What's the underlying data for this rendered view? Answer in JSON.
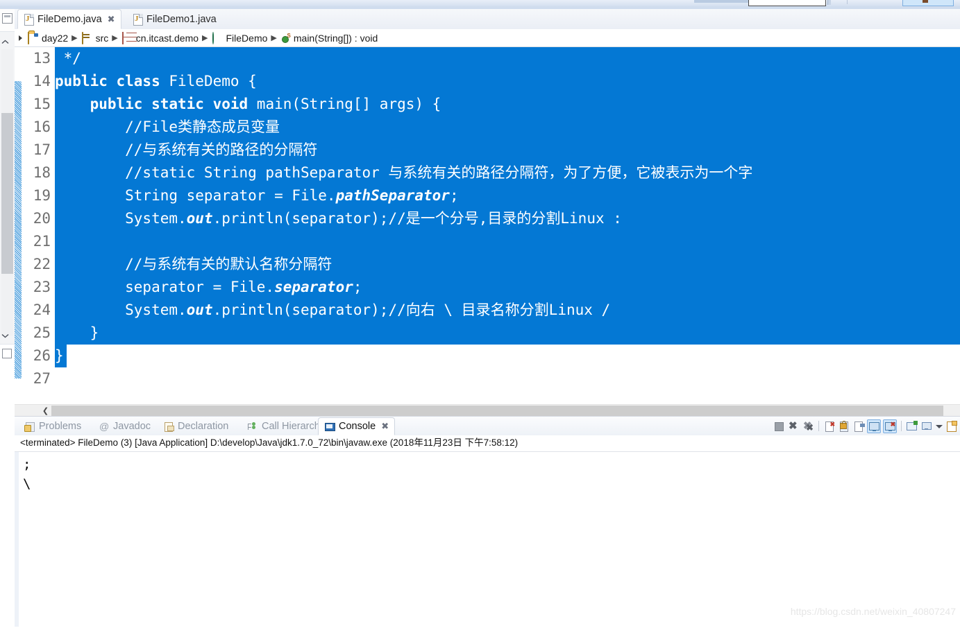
{
  "editor": {
    "tabs": [
      {
        "label": "FileDemo.java",
        "icon": "java-file-icon",
        "active": true,
        "closeable": true
      },
      {
        "label": "FileDemo1.java",
        "icon": "java-file-icon",
        "active": false,
        "closeable": false
      }
    ],
    "breadcrumb": [
      {
        "label": "day22",
        "icon": "project-folder-icon"
      },
      {
        "label": "src",
        "icon": "source-folder-icon"
      },
      {
        "label": "cn.itcast.demo",
        "icon": "package-icon"
      },
      {
        "label": "FileDemo",
        "icon": "class-icon"
      },
      {
        "label": "main(String[]) : void",
        "icon": "method-icon"
      }
    ],
    "selection_color": "#0478d4",
    "first_line_number": 13,
    "lines": [
      {
        "n": 13,
        "indent": 1,
        "text": " */",
        "selected": true
      },
      {
        "n": 14,
        "indent": 0,
        "text": "public class FileDemo {",
        "selected": true,
        "spans": [
          {
            "t": "public class ",
            "style": "bold"
          },
          {
            "t": "FileDemo {",
            "style": "plain"
          }
        ]
      },
      {
        "n": 15,
        "indent": 0,
        "text": "    public static void main(String[] args) {",
        "selected": true,
        "spans": [
          {
            "t": "    ",
            "style": "plain"
          },
          {
            "t": "public static void ",
            "style": "bold"
          },
          {
            "t": "main(String[] args) {",
            "style": "plain"
          }
        ]
      },
      {
        "n": 16,
        "indent": 0,
        "text": "        //File类静态成员变量",
        "selected": true
      },
      {
        "n": 17,
        "indent": 0,
        "text": "        //与系统有关的路径的分隔符",
        "selected": true
      },
      {
        "n": 18,
        "indent": 0,
        "text": "        //static String pathSeparator 与系统有关的路径分隔符，为了方便，它被表示为一个字",
        "selected": true,
        "clipped": true
      },
      {
        "n": 19,
        "indent": 0,
        "text": "        String separator = File.pathSeparator;",
        "selected": true,
        "spans": [
          {
            "t": "        String separator = File.",
            "style": "plain"
          },
          {
            "t": "pathSeparator",
            "style": "bold-italic"
          },
          {
            "t": ";",
            "style": "plain"
          }
        ]
      },
      {
        "n": 20,
        "indent": 0,
        "text": "        System.out.println(separator);//是一个分号,目录的分割Linux :",
        "selected": true,
        "spans": [
          {
            "t": "        System.",
            "style": "plain"
          },
          {
            "t": "out",
            "style": "bold-italic"
          },
          {
            "t": ".println(separator);//是一个分号,目录的分割Linux :",
            "style": "plain"
          }
        ]
      },
      {
        "n": 21,
        "indent": 0,
        "text": "",
        "selected": true
      },
      {
        "n": 22,
        "indent": 0,
        "text": "        //与系统有关的默认名称分隔符",
        "selected": true
      },
      {
        "n": 23,
        "indent": 0,
        "text": "        separator = File.separator;",
        "selected": true,
        "spans": [
          {
            "t": "        separator = File.",
            "style": "plain"
          },
          {
            "t": "separator",
            "style": "bold-italic"
          },
          {
            "t": ";",
            "style": "plain"
          }
        ]
      },
      {
        "n": 24,
        "indent": 0,
        "text": "        System.out.println(separator);//向右 \\ 目录名称分割Linux /",
        "selected": true,
        "spans": [
          {
            "t": "        System.",
            "style": "plain"
          },
          {
            "t": "out",
            "style": "bold-italic"
          },
          {
            "t": ".println(separator);//向右 \\ 目录名称分割Linux /",
            "style": "plain"
          }
        ]
      },
      {
        "n": 25,
        "indent": 0,
        "text": "    }",
        "selected": true
      },
      {
        "n": 26,
        "indent": 0,
        "text": "}",
        "selected": true
      },
      {
        "n": 27,
        "indent": 0,
        "text": "",
        "selected": false
      }
    ]
  },
  "bottom": {
    "tabs": [
      {
        "label": "Problems",
        "icon": "problems-icon",
        "active": false
      },
      {
        "label": "Javadoc",
        "icon": "javadoc-icon",
        "active": false
      },
      {
        "label": "Declaration",
        "icon": "declaration-icon",
        "active": false
      },
      {
        "label": "Call Hierarchy",
        "icon": "call-hierarchy-icon",
        "active": false
      },
      {
        "label": "Console",
        "icon": "console-icon",
        "active": true,
        "closeable": true
      }
    ],
    "toolbar_icons": [
      "terminate-icon",
      "remove-launch-icon",
      "remove-all-terminated-icon",
      "clear-console-icon",
      "scroll-lock-icon",
      "pin-console-icon",
      "display-selected-console-icon",
      "open-console-icon",
      "new-console-view-icon",
      "show-console-icon",
      "console-dropdown-icon",
      "new-console-icon"
    ],
    "console": {
      "header": "<terminated> FileDemo (3) [Java Application] D:\\develop\\Java\\jdk1.7.0_72\\bin\\javaw.exe (2018年11月23日 下午7:58:12)",
      "output": ";\n\\"
    }
  },
  "watermark": "https://blog.csdn.net/weixin_40807247"
}
